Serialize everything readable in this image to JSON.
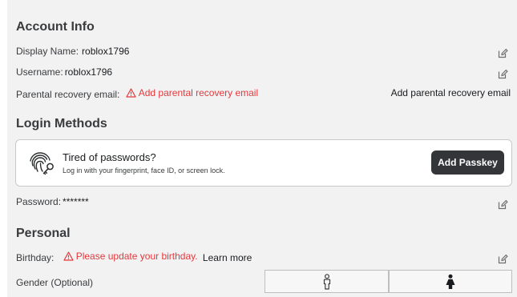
{
  "account_info": {
    "heading": "Account Info",
    "display_name_label": "Display Name:",
    "display_name_value": "roblox1796",
    "username_label": "Username:",
    "username_value": "roblox1796",
    "parental_label": "Parental recovery email:",
    "parental_warning": "Add parental recovery email",
    "parental_action": "Add parental recovery email"
  },
  "login_methods": {
    "heading": "Login Methods",
    "passkey_title": "Tired of passwords?",
    "passkey_subtitle": "Log in with your fingerprint, face ID, or screen lock.",
    "passkey_button": "Add Passkey",
    "password_label": "Password:",
    "password_value": "*******"
  },
  "personal": {
    "heading": "Personal",
    "birthday_label": "Birthday:",
    "birthday_warning": "Please update your birthday.",
    "birthday_link": "Learn more",
    "gender_label": "Gender (Optional)"
  },
  "colors": {
    "warning": "#e4393c",
    "button_bg": "#333538",
    "text": "#393b3d"
  },
  "icons": [
    "edit-icon",
    "warning-icon",
    "fingerprint-key-icon",
    "male-icon",
    "female-icon"
  ]
}
